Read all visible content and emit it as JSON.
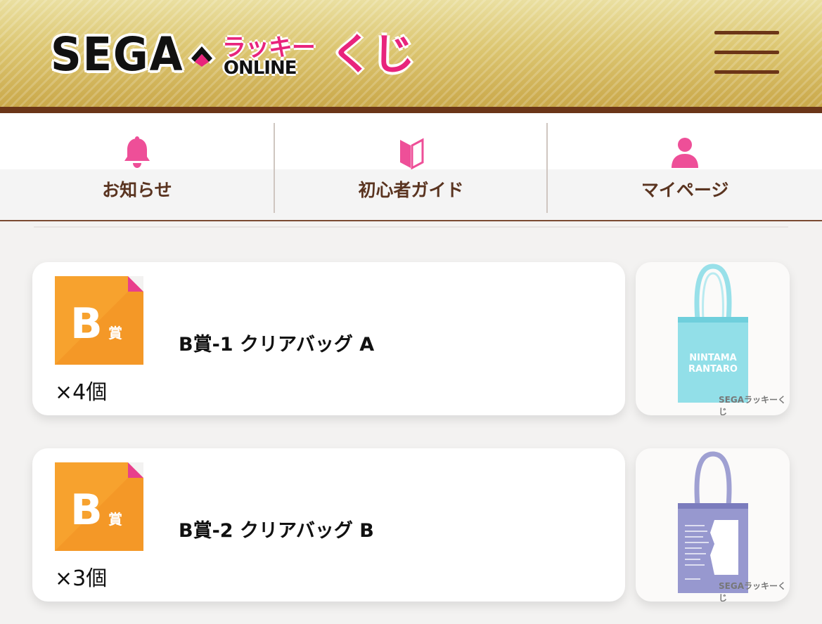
{
  "header": {
    "logo": {
      "brand": "SEGA",
      "lucky": "ラッキー",
      "online": "ONLINE",
      "kuji": "くじ"
    },
    "menu_icon": "hamburger-menu-icon",
    "colors": {
      "accent": "#e8247c",
      "brown": "#6b3518"
    }
  },
  "nav": {
    "items": [
      {
        "label": "お知らせ",
        "icon": "bell-icon"
      },
      {
        "label": "初心者ガイド",
        "icon": "beginner-mark-icon"
      },
      {
        "label": "マイページ",
        "icon": "person-icon"
      }
    ]
  },
  "prizes": [
    {
      "badge_letter": "B",
      "badge_suffix": "賞",
      "name": "B賞-1 クリアバッグ A",
      "count": "×4個",
      "bag_color": "#86dbe6",
      "bag_text": "NINTAMA\nRANTARO",
      "watermark": "SEGAラッキーくじ"
    },
    {
      "badge_letter": "B",
      "badge_suffix": "賞",
      "name": "B賞-2 クリアバッグ B",
      "count": "×3個",
      "bag_color": "#8e8fcb",
      "watermark": "SEGAラッキーくじ"
    }
  ]
}
